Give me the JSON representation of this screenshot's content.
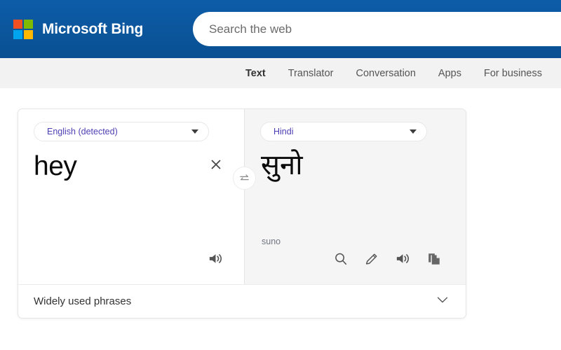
{
  "header": {
    "brand_name": "Microsoft Bing",
    "logo_icon": "microsoft-logo-icon",
    "logo_colors": {
      "top_left": "#f25022",
      "top_right": "#7fba00",
      "bottom_left": "#00a4ef",
      "bottom_right": "#ffb900"
    },
    "background_color": "#0b5398",
    "search": {
      "placeholder": "Search the web",
      "value": ""
    }
  },
  "nav": {
    "tabs": [
      {
        "label": "Text",
        "active": true
      },
      {
        "label": "Translator",
        "active": false
      },
      {
        "label": "Conversation",
        "active": false
      },
      {
        "label": "Apps",
        "active": false
      },
      {
        "label": "For business",
        "active": false
      }
    ]
  },
  "translator": {
    "source": {
      "language": "English (detected)",
      "text": "hey",
      "clear_icon": "close-icon",
      "actions": [
        {
          "icon": "speaker-icon",
          "name": "listen-source-button"
        }
      ]
    },
    "swap": {
      "icon": "swap-arrows-icon"
    },
    "target": {
      "language": "Hindi",
      "text": "सुनो",
      "transliteration": "suno",
      "actions": [
        {
          "icon": "search-icon",
          "name": "search-translation-button"
        },
        {
          "icon": "pencil-icon",
          "name": "edit-translation-button"
        },
        {
          "icon": "speaker-icon",
          "name": "listen-translation-button"
        },
        {
          "icon": "copy-icon",
          "name": "copy-translation-button"
        }
      ]
    },
    "phrases": {
      "label": "Widely used phrases",
      "expand_icon": "chevron-down-icon"
    },
    "language_text_color": "#4b3fb5"
  }
}
